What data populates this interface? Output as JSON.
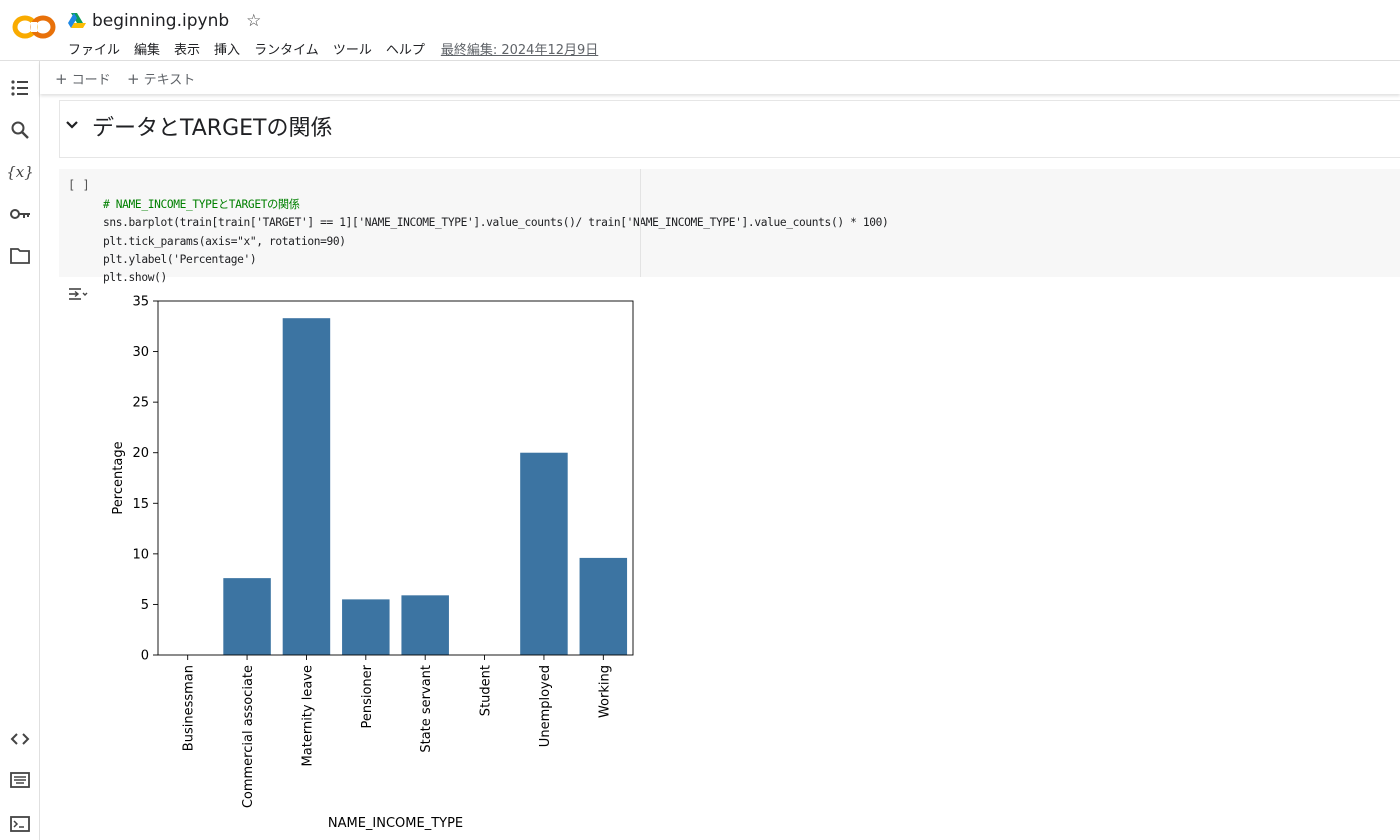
{
  "app": {
    "notebook_title": "beginning.ipynb",
    "logo_text": "CO"
  },
  "menu": {
    "items": [
      "ファイル",
      "編集",
      "表示",
      "挿入",
      "ランタイム",
      "ツール",
      "ヘルプ"
    ],
    "last_edit": "最終編集: 2024年12月9日"
  },
  "toolbar": {
    "add_code_label": "コード",
    "add_text_label": "テキスト"
  },
  "text_cell": {
    "heading": "データとTARGETの関係"
  },
  "code_cell": {
    "run_indicator": "[ ]",
    "lines": [
      "# NAME_INCOME_TYPEとTARGETの関係",
      "sns.barplot(train[train['TARGET'] == 1]['NAME_INCOME_TYPE'].value_counts()/ train['NAME_INCOME_TYPE'].value_counts() * 100)",
      "plt.tick_params(axis=\"x\", rotation=90)",
      "plt.ylabel('Percentage')",
      "plt.show()"
    ]
  },
  "chart_data": {
    "type": "bar",
    "categories": [
      "Businessman",
      "Commercial associate",
      "Maternity leave",
      "Pensioner",
      "State servant",
      "Student",
      "Unemployed",
      "Working"
    ],
    "values": [
      0,
      7.6,
      33.3,
      5.5,
      5.9,
      0,
      20.0,
      9.6
    ],
    "xlabel": "NAME_INCOME_TYPE",
    "ylabel": "Percentage",
    "ylim": [
      0,
      35
    ],
    "yticks": [
      0,
      5,
      10,
      15,
      20,
      25,
      30,
      35
    ],
    "bar_color": "#3c74a2",
    "grid": false
  },
  "colors": {
    "logo_orange": "#f9ab00",
    "logo_dark_orange": "#e37400",
    "bar": "#3c74a2"
  }
}
